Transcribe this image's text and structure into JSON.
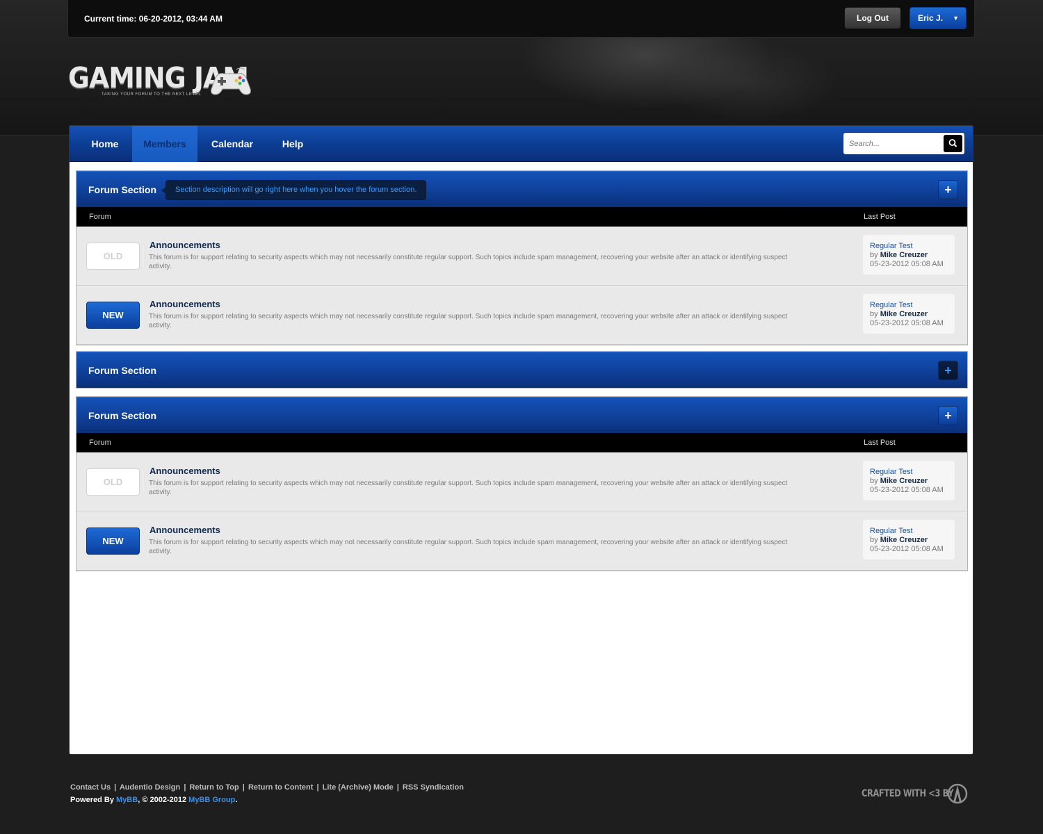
{
  "header": {
    "current_time": "Current time: 06-20-2012, 03:44 AM",
    "logout_label": "Log Out",
    "user_label": "Eric J.",
    "user_caret": "▼",
    "logo_text": "GAMING JAM",
    "logo_tagline": "TAKING YOUR FORUM TO THE NEXT LEVEL"
  },
  "nav": {
    "items": [
      {
        "label": "Home"
      },
      {
        "label": "Members"
      },
      {
        "label": "Calendar"
      },
      {
        "label": "Help"
      }
    ],
    "active": "Members",
    "search_placeholder": "Search..."
  },
  "sections": [
    {
      "title": "Forum Section",
      "description": "Section description will go right here when you hover the forum section.",
      "expand_label": "+",
      "col_forum": "Forum",
      "col_lastpost": "Last Post",
      "forums": [
        {
          "status": "OLD",
          "name": "Announcements",
          "description": "This forum is for support relating to security aspects which may not necessarily constitute regular support. Such topics include spam management, recovering your website after an attack or identifying suspect activity.",
          "last_title": "Regular Test",
          "last_by": "by",
          "last_author": "Mike Creuzer",
          "last_date": "05-23-2012 05:08 AM"
        },
        {
          "status": "NEW",
          "name": "Announcements",
          "description": "This forum is for support relating to security aspects which may not necessarily constitute regular support. Such topics include spam management, recovering your website after an attack or identifying suspect activity.",
          "last_title": "Regular Test",
          "last_by": "by",
          "last_author": "Mike Creuzer",
          "last_date": "05-23-2012 05:08 AM"
        }
      ]
    },
    {
      "title": "Forum Section",
      "expand_label": "+"
    },
    {
      "title": "Forum Section",
      "expand_label": "+",
      "col_forum": "Forum",
      "col_lastpost": "Last Post",
      "forums": [
        {
          "status": "OLD",
          "name": "Announcements",
          "description": "This forum is for support relating to security aspects which may not necessarily constitute regular support. Such topics include spam management, recovering your website after an attack or identifying suspect activity.",
          "last_title": "Regular Test",
          "last_by": "by",
          "last_author": "Mike Creuzer",
          "last_date": "05-23-2012 05:08 AM"
        },
        {
          "status": "NEW",
          "name": "Announcements",
          "description": "This forum is for support relating to security aspects which may not necessarily constitute regular support. Such topics include spam management, recovering your website after an attack or identifying suspect activity.",
          "last_title": "Regular Test",
          "last_by": "by",
          "last_author": "Mike Creuzer",
          "last_date": "05-23-2012 05:08 AM"
        }
      ]
    }
  ],
  "footer": {
    "links": [
      "Contact Us",
      "Audentio Design",
      "Return to Top",
      "Return to Content",
      "Lite (Archive) Mode",
      "RSS Syndication"
    ],
    "link_separator": "|",
    "powered_prefix": "Powered By",
    "powered_mybb": "MyBB",
    "powered_middle": ", © 2002-2012",
    "powered_group": "MyBB Group",
    "powered_suffix": ".",
    "crafted": "CRAFTED WITH <3 BY"
  },
  "colors": {
    "accent": "#0f4099",
    "link": "#1a4f9e",
    "tooltip_text": "#3b9bff"
  }
}
